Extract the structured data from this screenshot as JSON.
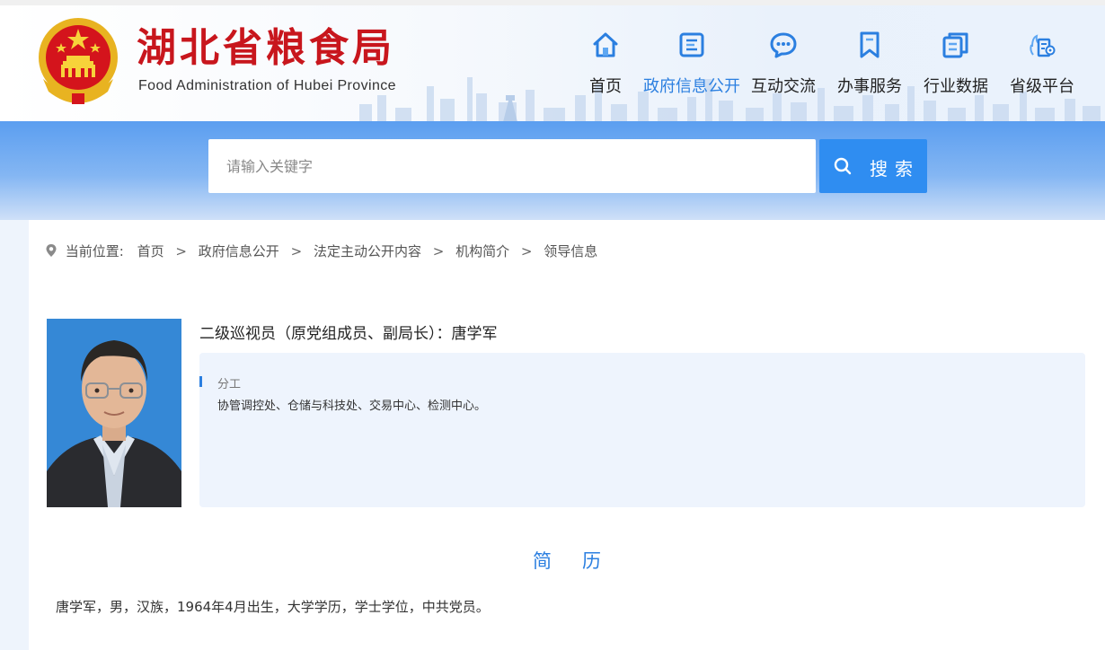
{
  "site": {
    "title": "湖北省粮食局",
    "subtitle": "Food Administration of Hubei Province"
  },
  "nav": [
    {
      "label": "首页",
      "icon": "home-icon",
      "active": false
    },
    {
      "label": "政府信息公开",
      "icon": "document-icon",
      "active": true
    },
    {
      "label": "互动交流",
      "icon": "chat-icon",
      "active": false
    },
    {
      "label": "办事服务",
      "icon": "bookmark-icon",
      "active": false
    },
    {
      "label": "行业数据",
      "icon": "data-icon",
      "active": false
    },
    {
      "label": "省级平台",
      "icon": "platform-icon",
      "active": false
    }
  ],
  "search": {
    "placeholder": "请输入关键字",
    "button_label": "搜索"
  },
  "breadcrumb": {
    "prefix": "当前位置:",
    "items": [
      "首页",
      "政府信息公开",
      "法定主动公开内容",
      "机构简介",
      "领导信息"
    ],
    "separator": ">"
  },
  "leader": {
    "title": "二级巡视员（原党组成员、副局长）：唐学军",
    "duty_label": "分工",
    "duty_text": "协管调控处、仓储与科技处、交易中心、检测中心。",
    "resume_heading": "简历",
    "bio": "唐学军，男，汉族，1964年4月出生，大学学历，学士学位，中共党员。"
  },
  "colors": {
    "brand_red": "#c8161d",
    "accent_blue": "#2b7fe0",
    "search_button": "#2f8df1"
  }
}
